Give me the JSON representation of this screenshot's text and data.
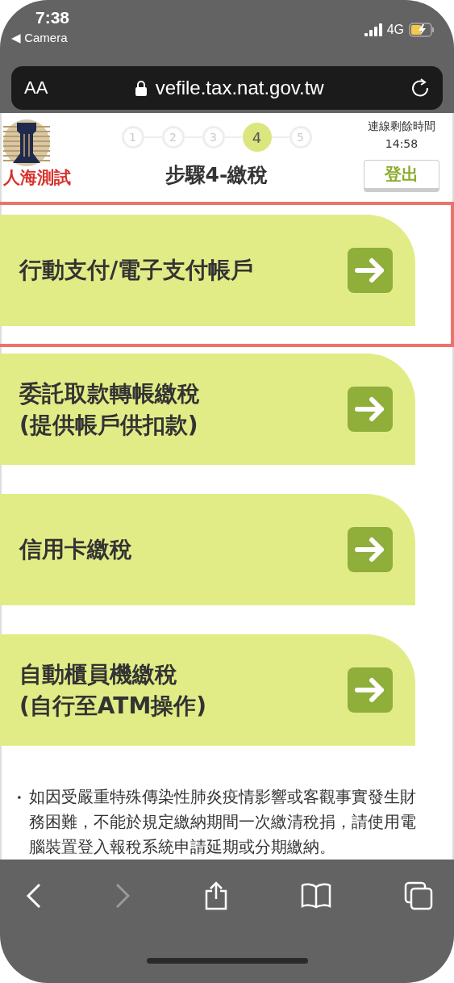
{
  "status_bar": {
    "time": "7:38",
    "back_app": "◀ Camera",
    "network": "4G",
    "charging": true
  },
  "address_bar": {
    "text_size": "AA",
    "url": "vefile.tax.nat.gov.tw"
  },
  "header": {
    "org_name": "人海測試",
    "steps": [
      {
        "label": "1",
        "selected": false
      },
      {
        "label": "2",
        "selected": false
      },
      {
        "label": "3",
        "selected": false
      },
      {
        "label": "4",
        "selected": true
      },
      {
        "label": "5",
        "selected": false
      }
    ],
    "title": "步驟4-繳稅",
    "timer_label": "連線剩餘時間",
    "timer": "14:58",
    "logout": "登出"
  },
  "options": [
    {
      "lines": [
        "行動支付/電子支付帳戶"
      ],
      "selected": true
    },
    {
      "lines": [
        "委託取款轉帳繳稅",
        "(提供帳戶供扣款)"
      ],
      "selected": false
    },
    {
      "lines": [
        "信用卡繳稅"
      ],
      "selected": false
    },
    {
      "lines": [
        "自動櫃員機繳稅",
        "(自行至ATM操作)"
      ],
      "selected": false
    }
  ],
  "notes": [
    "如因受嚴重特殊傳染性肺炎疫情影響或客觀事實發生財務困難，不能於規定繳納期間一次繳清稅捐，請使用電腦裝置登入報稅系統申請延期或分期繳納。"
  ],
  "toolbar": {
    "back_enabled": true,
    "forward_enabled": false
  }
}
